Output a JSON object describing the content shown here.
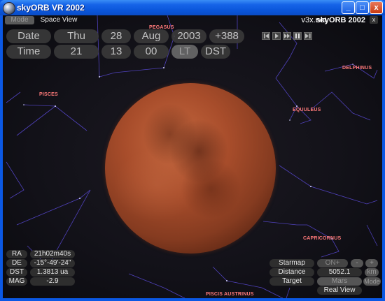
{
  "window": {
    "title": "skyORB VR 2002",
    "buttons": [
      "_",
      "□",
      "x"
    ],
    "accent": "#0a55d9"
  },
  "menu": {
    "mode": "Mode",
    "space_view": "Space View",
    "brand_site": "v3x.net",
    "brand_name": "skyORB 2002",
    "close": "x"
  },
  "date_row": [
    "Date",
    "Thu",
    "28",
    "Aug",
    "2003",
    "+388"
  ],
  "time_row": [
    "Time",
    "21",
    "13",
    "00",
    "LT",
    "DST"
  ],
  "constellations": {
    "pegasus": "PEGASUS",
    "pisces": "PISCES",
    "delphinus": "DELPHINUS",
    "equuleus": "EQUULEUS",
    "capricornus": "CAPRICORNUS",
    "piscis_austrinus": "PISCIS AUSTRINUS"
  },
  "info": [
    {
      "label": "RA",
      "value": "21h02m40s"
    },
    {
      "label": "DE",
      "value": "-15°-49'-24\""
    },
    {
      "label": "DST",
      "value": "1.3813 ua"
    },
    {
      "label": "MAG",
      "value": "-2.9"
    }
  ],
  "controls": {
    "starmap_label": "Starmap",
    "starmap_value": "ON+",
    "minus": "-",
    "plus": "+",
    "distance_label": "Distance",
    "distance_value": "5052.1",
    "distance_unit": "km",
    "target_label": "Target",
    "target_value": "Mars",
    "mode": "Mode",
    "real_view": "Real View"
  },
  "colors": {
    "constellation_text": "#ff7a7a",
    "constellation_lines": "#5a4ad8",
    "mars": "#a84d2b"
  }
}
